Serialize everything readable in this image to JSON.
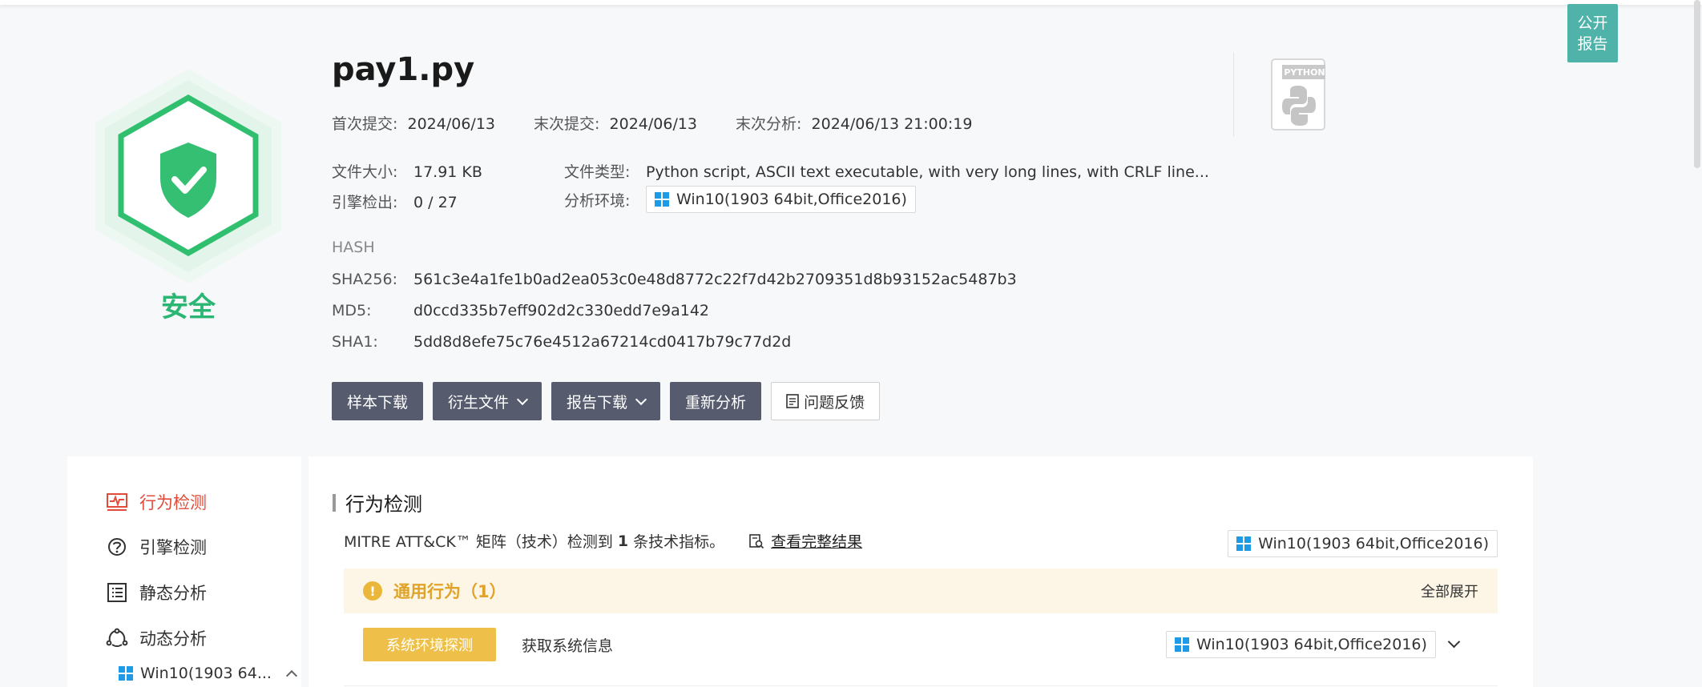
{
  "header": {
    "public_report": [
      "公开",
      "报告"
    ]
  },
  "verdict": {
    "label": "安全",
    "color": "#2bb673"
  },
  "file": {
    "name": "pay1.py",
    "first_submit_label": "首次提交:",
    "first_submit": "2024/06/13",
    "last_submit_label": "末次提交:",
    "last_submit": "2024/06/13",
    "last_analysis_label": "末次分析:",
    "last_analysis": "2024/06/13 21:00:19",
    "size_label": "文件大小:",
    "size": "17.91 KB",
    "type_label": "文件类型:",
    "type": "Python script, ASCII text executable, with very long lines, with CRLF line...",
    "engine_label": "引擎检出:",
    "engine": "0 / 27",
    "env_label": "分析环境:",
    "env": "Win10(1903 64bit,Office2016)",
    "type_icon_text": "PYTHON"
  },
  "hash": {
    "title": "HASH",
    "sha256_label": "SHA256:",
    "sha256": "561c3e4a1fe1b0ad2ea053c0e48d8772c22f7d42b2709351d8b93152ac5487b3",
    "md5_label": "MD5:",
    "md5": "d0ccd335b7eff902d2c330edd7e9a142",
    "sha1_label": "SHA1:",
    "sha1": "5dd8d8efe75c76e4512a67214cd0417b79c77d2d"
  },
  "actions": {
    "download_sample": "样本下载",
    "derived_files": "衍生文件",
    "report_download": "报告下载",
    "reanalyze": "重新分析",
    "feedback": "问题反馈"
  },
  "sidebar": {
    "items": [
      {
        "label": "行为检测",
        "active": true
      },
      {
        "label": "引擎检测"
      },
      {
        "label": "静态分析"
      },
      {
        "label": "动态分析"
      }
    ],
    "sub_env": "Win10(1903 64..."
  },
  "main": {
    "section_title": "行为检测",
    "mitre_prefix": "MITRE ATT&CK™ 矩阵（技术）检测到",
    "mitre_count": "1",
    "mitre_suffix": "条技术指标。",
    "view_full": "查看完整结果",
    "env": "Win10(1903 64bit,Office2016)",
    "group": {
      "title": "通用行为（1）",
      "expand_all": "全部展开",
      "icon": "!"
    },
    "behaviors": [
      {
        "tag": "系统环境探测",
        "desc": "获取系统信息",
        "env": "Win10(1903 64bit,Office2016)"
      }
    ]
  },
  "colors": {
    "accent_red": "#e04b3a",
    "button_dark": "#565b6e",
    "public_btn": "#4fb3a9",
    "warn": "#e0a32a"
  }
}
